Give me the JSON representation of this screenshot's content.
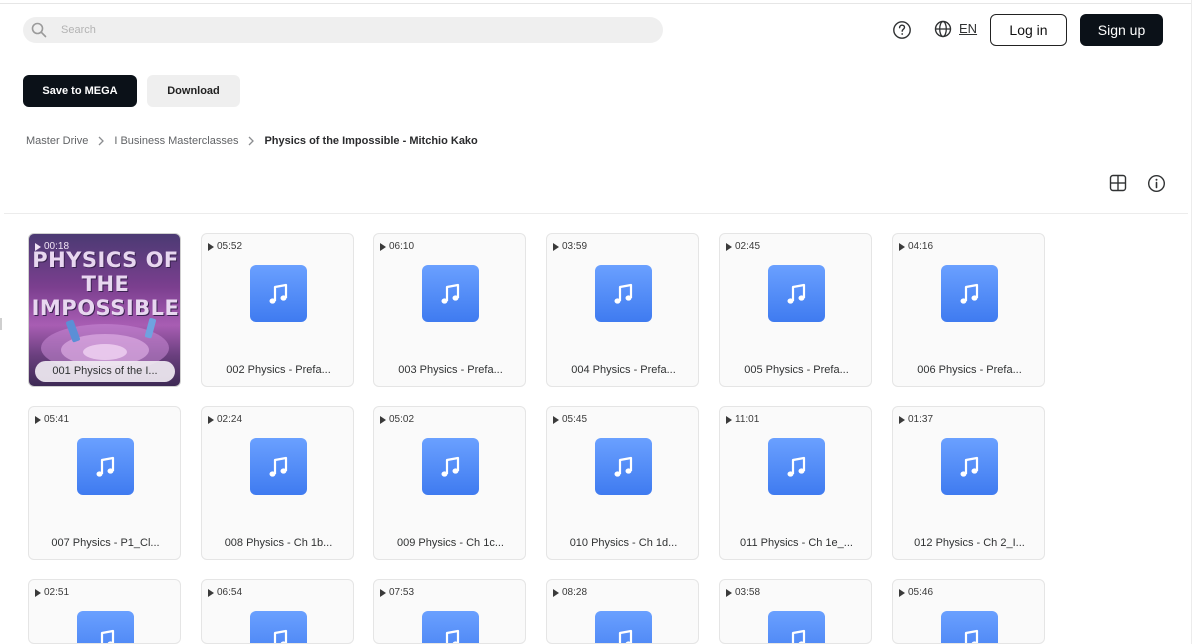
{
  "header": {
    "search_placeholder": "Search",
    "language": "EN",
    "login_label": "Log in",
    "signup_label": "Sign up"
  },
  "actions": {
    "save_label": "Save to MEGA",
    "download_label": "Download"
  },
  "breadcrumb": [
    "Master Drive",
    "I Business Masterclasses",
    "Physics of the Impossible - Mitchio Kako"
  ],
  "cover": {
    "title_line1": "PHYSICS OF THE",
    "title_line2": "IMPOSSIBLE"
  },
  "files": [
    {
      "duration": "00:18",
      "name": "001 Physics of the I...",
      "cover": true
    },
    {
      "duration": "05:52",
      "name": "002 Physics - Prefa..."
    },
    {
      "duration": "06:10",
      "name": "003 Physics - Prefa..."
    },
    {
      "duration": "03:59",
      "name": "004 Physics - Prefa..."
    },
    {
      "duration": "02:45",
      "name": "005 Physics - Prefa..."
    },
    {
      "duration": "04:16",
      "name": "006 Physics - Prefa..."
    },
    {
      "duration": "05:41",
      "name": "007 Physics - P1_Cl..."
    },
    {
      "duration": "02:24",
      "name": "008 Physics - Ch 1b..."
    },
    {
      "duration": "05:02",
      "name": "009 Physics - Ch 1c..."
    },
    {
      "duration": "05:45",
      "name": "010 Physics - Ch 1d..."
    },
    {
      "duration": "11:01",
      "name": "011 Physics - Ch 1e_..."
    },
    {
      "duration": "01:37",
      "name": "012 Physics - Ch 2_I..."
    },
    {
      "duration": "02:51",
      "name": ""
    },
    {
      "duration": "06:54",
      "name": ""
    },
    {
      "duration": "07:53",
      "name": ""
    },
    {
      "duration": "08:28",
      "name": ""
    },
    {
      "duration": "03:58",
      "name": ""
    },
    {
      "duration": "05:46",
      "name": ""
    }
  ],
  "colors": {
    "primary_dark": "#0b1118",
    "music_icon_blue": "#4f8bf6",
    "tile_border": "#e5e5e5"
  },
  "icons": {
    "search": "search-icon",
    "help": "help-circle-icon",
    "globe": "globe-icon",
    "view": "grid-view-icon",
    "info": "info-icon",
    "music": "music-note-icon"
  }
}
